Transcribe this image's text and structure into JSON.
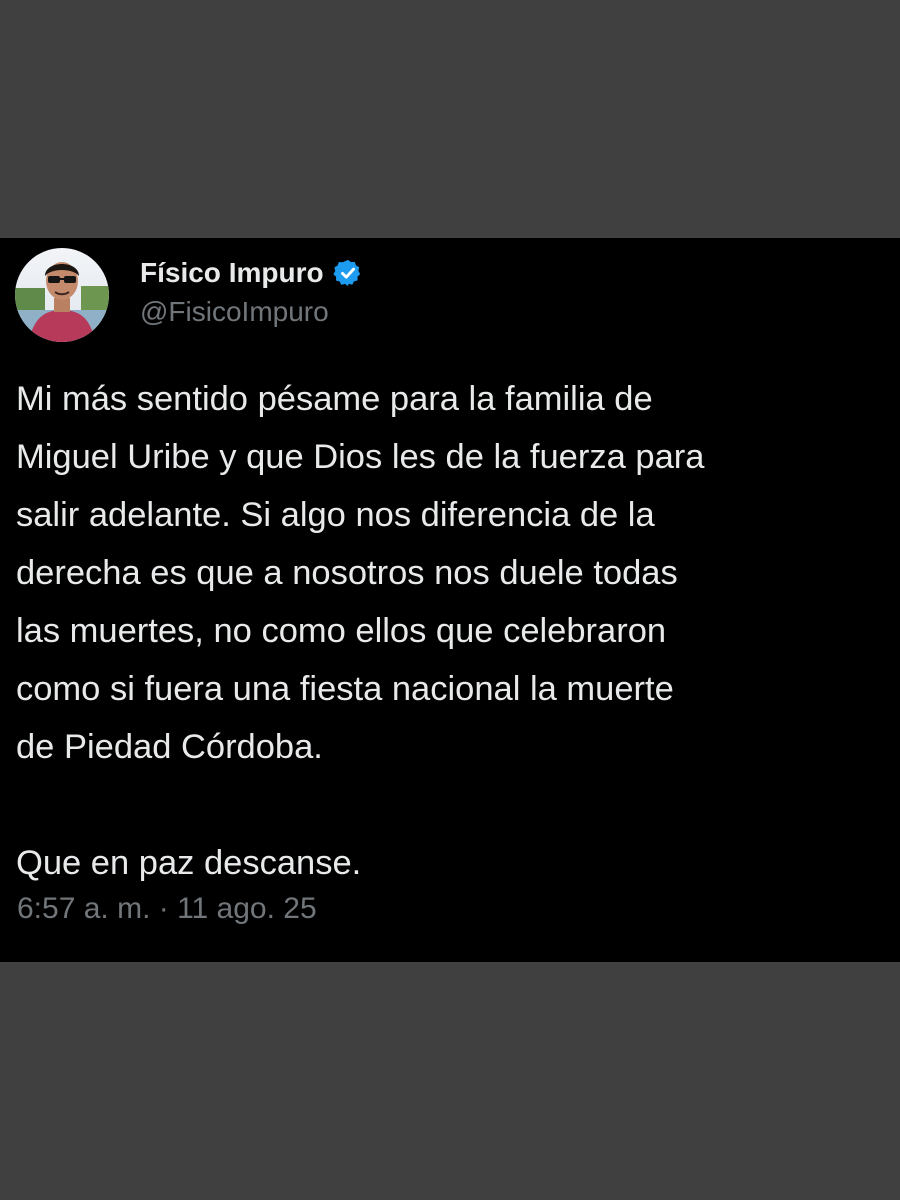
{
  "author": {
    "display_name": "Físico Impuro",
    "handle": "@FisicoImpuro",
    "avatar_icon": "profile-photo",
    "verified_icon": "verified-badge-icon",
    "verified_color": "#1d9bf0"
  },
  "tweet": {
    "text": "Mi más sentido pésame para la familia de\nMiguel Uribe y que Dios les de la fuerza para\nsalir adelante. Si algo nos diferencia de la\nderecha es que a nosotros nos duele todas\nlas muertes, no como ellos que celebraron\ncomo si fuera una fiesta nacional la muerte\nde Piedad Córdoba.\n\nQue en paz descanse.",
    "timestamp": "6:57 a. m. · 11 ago. 25"
  },
  "colors": {
    "page_background": "#404040",
    "card_background": "#000000",
    "primary_text": "#e7e9ea",
    "secondary_text": "#71767b"
  }
}
